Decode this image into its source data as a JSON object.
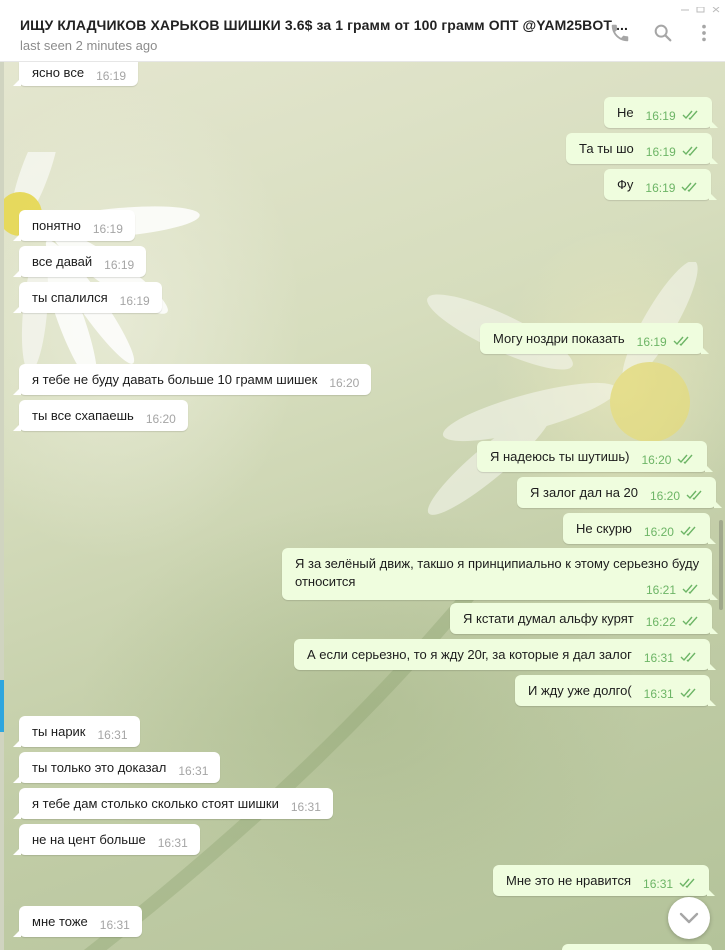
{
  "header": {
    "title": "ИЩУ КЛАДЧИКОВ ХАРЬКОВ ШИШКИ 3.6$ за 1 грамм от 100 грамм ОПТ @YAM25BOT ...",
    "status": "last seen 2 minutes ago",
    "icons": [
      "phone-icon",
      "search-icon",
      "more-vertical-icon"
    ]
  },
  "colors": {
    "incoming_bubble": "#ffffff",
    "outgoing_bubble": "#effdde",
    "read_ticks": "#6db566",
    "accent_blue": "#2ea6de"
  },
  "messages": [
    {
      "dir": "in",
      "text": "ясно все",
      "time": "16:19"
    },
    {
      "dir": "out",
      "text": "Не",
      "time": "16:19"
    },
    {
      "dir": "out",
      "text": "Та ты шо",
      "time": "16:19"
    },
    {
      "dir": "out",
      "text": "Фу",
      "time": "16:19"
    },
    {
      "dir": "in",
      "text": "понятно",
      "time": "16:19"
    },
    {
      "dir": "in",
      "text": "все давай",
      "time": "16:19"
    },
    {
      "dir": "in",
      "text": "ты спалился",
      "time": "16:19"
    },
    {
      "dir": "out",
      "text": "Могу ноздри показать",
      "time": "16:19"
    },
    {
      "dir": "in",
      "text": "я тебе не буду давать больше 10 грамм шишек",
      "time": "16:20"
    },
    {
      "dir": "in",
      "text": "ты все схапаешь",
      "time": "16:20"
    },
    {
      "dir": "out",
      "text": "Я надеюсь ты шутишь)",
      "time": "16:20"
    },
    {
      "dir": "out",
      "text": "Я залог дал на 20",
      "time": "16:20"
    },
    {
      "dir": "out",
      "text": "Не скурю",
      "time": "16:20"
    },
    {
      "dir": "out",
      "text": "Я за зелёный движ, такшо я принципиально к этому серьезно буду относится",
      "time": "16:21"
    },
    {
      "dir": "out",
      "text": "Я кстати думал альфу курят",
      "time": "16:22"
    },
    {
      "dir": "out",
      "text": "А если серьезно, то я жду 20г, за которые я дал залог",
      "time": "16:31"
    },
    {
      "dir": "out",
      "text": "И жду уже долго(",
      "time": "16:31"
    },
    {
      "dir": "in",
      "text": "ты нарик",
      "time": "16:31"
    },
    {
      "dir": "in",
      "text": "ты только это доказал",
      "time": "16:31"
    },
    {
      "dir": "in",
      "text": "я тебе дам столько сколько стоят шишки",
      "time": "16:31"
    },
    {
      "dir": "in",
      "text": "не на цент больше",
      "time": "16:31"
    },
    {
      "dir": "out",
      "text": "Мне это не нравится",
      "time": "16:31"
    },
    {
      "dir": "in",
      "text": "мне тоже",
      "time": "16:31"
    }
  ]
}
